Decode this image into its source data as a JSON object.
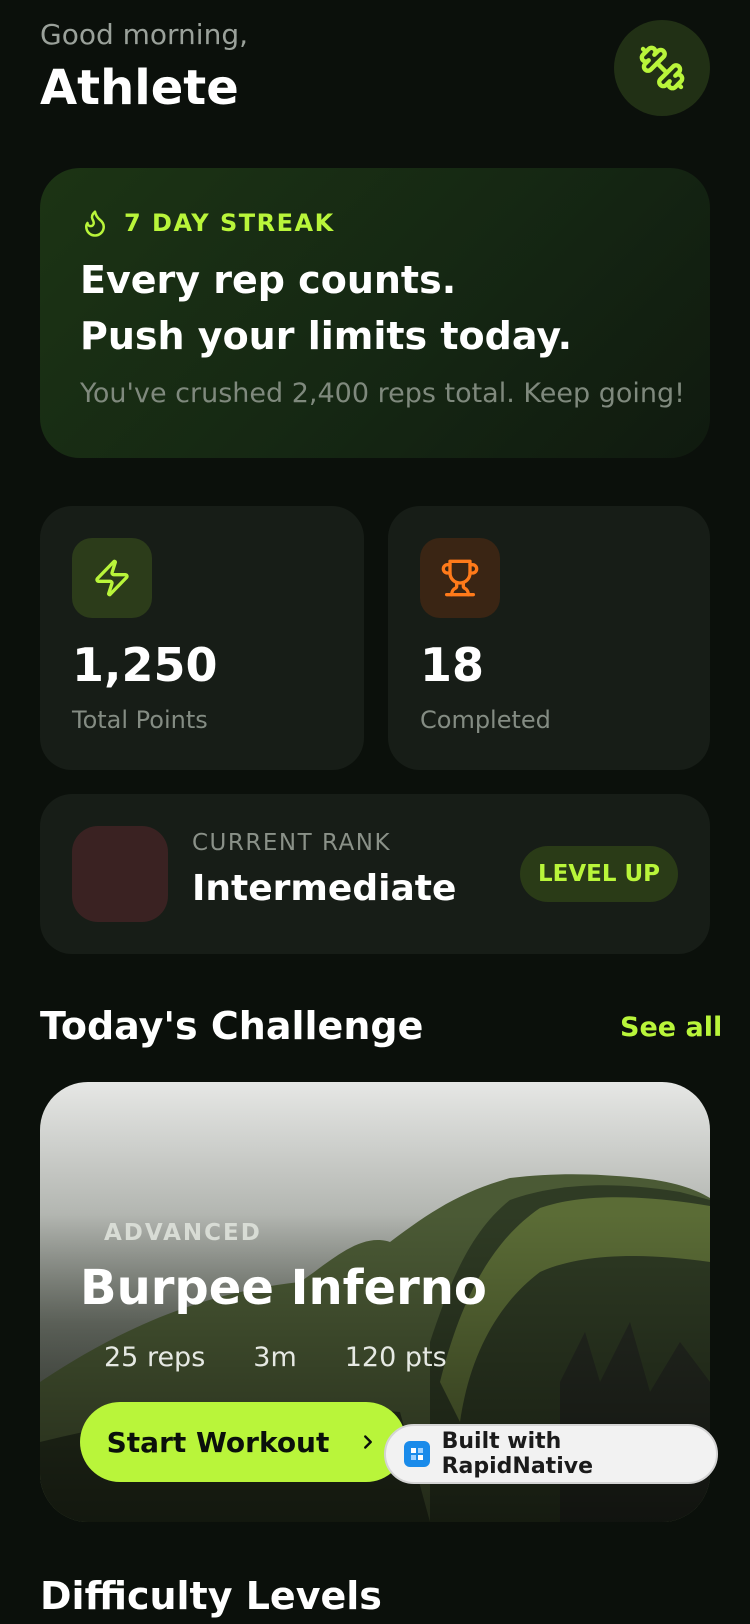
{
  "header": {
    "greeting": "Good morning,",
    "name": "Athlete",
    "icon": "dumbbell-icon"
  },
  "streak": {
    "label": "7 DAY STREAK",
    "icon": "flame-icon",
    "headline_line1": "Every rep counts.",
    "headline_line2": "Push your limits today.",
    "subtitle": "You've crushed 2,400 reps total. Keep going!"
  },
  "stats": [
    {
      "icon": "lightning-icon",
      "value": "1,250",
      "label": "Total Points",
      "icon_bg": "#2c3c1a",
      "icon_color": "#b9f53a"
    },
    {
      "icon": "trophy-icon",
      "value": "18",
      "label": "Completed",
      "icon_bg": "#3a2514",
      "icon_color": "#ff7a1a"
    }
  ],
  "rank": {
    "caption": "CURRENT RANK",
    "name": "Intermediate",
    "button": "LEVEL UP"
  },
  "challenge_section": {
    "title": "Today's Challenge",
    "see_all": "See all"
  },
  "challenge": {
    "level": "ADVANCED",
    "title": "Burpee Inferno",
    "reps": "25 reps",
    "duration": "3m",
    "points": "120 pts",
    "button": "Start Workout"
  },
  "badge": {
    "text": "Built with RapidNative"
  },
  "difficulty_section": {
    "title": "Difficulty Levels"
  },
  "colors": {
    "accent": "#b9f53a",
    "background": "#0b100b",
    "card": "#171d17"
  }
}
